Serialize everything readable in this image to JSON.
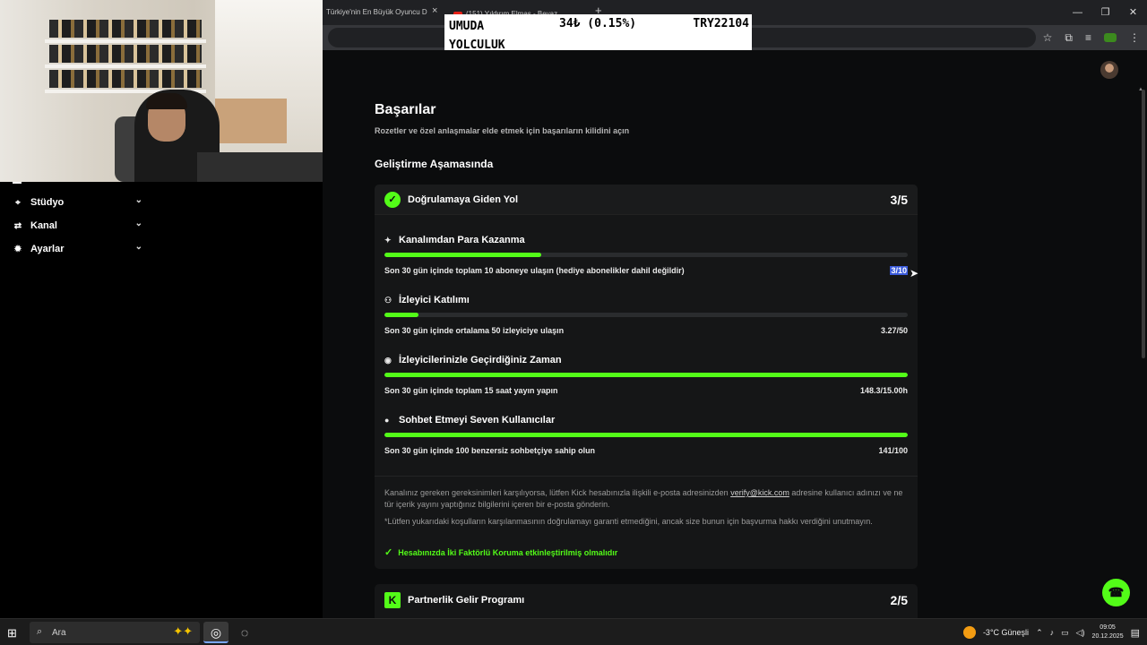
{
  "browser": {
    "tab1_title": "Türkiye'nin En Büyük Oyuncu D",
    "tab1_close": "×",
    "tab2_title": "(151) Yıldırım Elmas - Beyaz",
    "tab_new": "+",
    "controls": {
      "minimize": "—",
      "maximize": "❐",
      "close": "✕"
    }
  },
  "ticker": {
    "name": "UMUDA YOLCULUK",
    "change": "34₺ (0.15%)",
    "price": "TRY22104"
  },
  "sidebar": {
    "items": [
      {
        "label": "Stüdyo",
        "icon": "studio-icon"
      },
      {
        "label": "Kanal",
        "icon": "channel-icon"
      },
      {
        "label": "Ayarlar",
        "icon": "gear-icon"
      }
    ]
  },
  "page": {
    "title": "Başarılar",
    "subtitle": "Rozetler ve özel anlaşmalar elde etmek için başarıların kilidini açın",
    "section": "Geliştirme Aşamasında"
  },
  "verification_card": {
    "title": "Doğrulamaya Giden Yol",
    "count": "3/5",
    "requirements": [
      {
        "title": "Kanalımdan Para Kazanma",
        "icon": "sparkle-icon",
        "desc": "Son 30 gün içinde toplam 10 aboneye ulaşın (hediye abonelikler dahil değildir)",
        "value": "3/10",
        "progress": 0.3
      },
      {
        "title": "İzleyici Katılımı",
        "icon": "users-icon",
        "desc": "Son 30 gün içinde ortalama 50 izleyiciye ulaşın",
        "value": "3.27/50",
        "progress": 0.065
      },
      {
        "title": "İzleyicilerinizle Geçirdiğiniz Zaman",
        "icon": "broadcast-icon",
        "desc": "Son 30 gün içinde toplam 15 saat yayın yapın",
        "value": "148.3/15.00h",
        "progress": 1.0
      },
      {
        "title": "Sohbet Etmeyi Seven Kullanıcılar",
        "icon": "chat-icon",
        "desc": "Son 30 gün içinde 100 benzersiz sohbetçiye sahip olun",
        "value": "141/100",
        "progress": 1.0
      }
    ],
    "note1_pre": "Kanalınız gereken gereksinimleri karşılıyorsa, lütfen Kick hesabınızla ilişkili e-posta adresinizden ",
    "note1_email": "verify@kick.com",
    "note1_post": " adresine kullanıcı adınızı ve ne tür içerik yayını yaptığınız bilgilerini içeren bir e-posta gönderin.",
    "note2": "*Lütfen yukarıdaki koşulların karşılanmasının doğrulamayı garanti etmediğini, ancak size bunun için başvurma hakkı verdiğini unutmayın.",
    "twofa": "Hesabınızda İki Faktörlü Koruma etkinleştirilmiş olmalıdır"
  },
  "partner_card": {
    "title": "Partnerlik Gelir Programı",
    "count": "2/5"
  },
  "taskbar": {
    "search_label": "Ara",
    "weather": "-3°C  Güneşli",
    "time": "09:05",
    "date": "20.12.2025"
  },
  "colors": {
    "accent": "#53fc18",
    "bg": "#0b0c0d",
    "card": "#151617"
  }
}
